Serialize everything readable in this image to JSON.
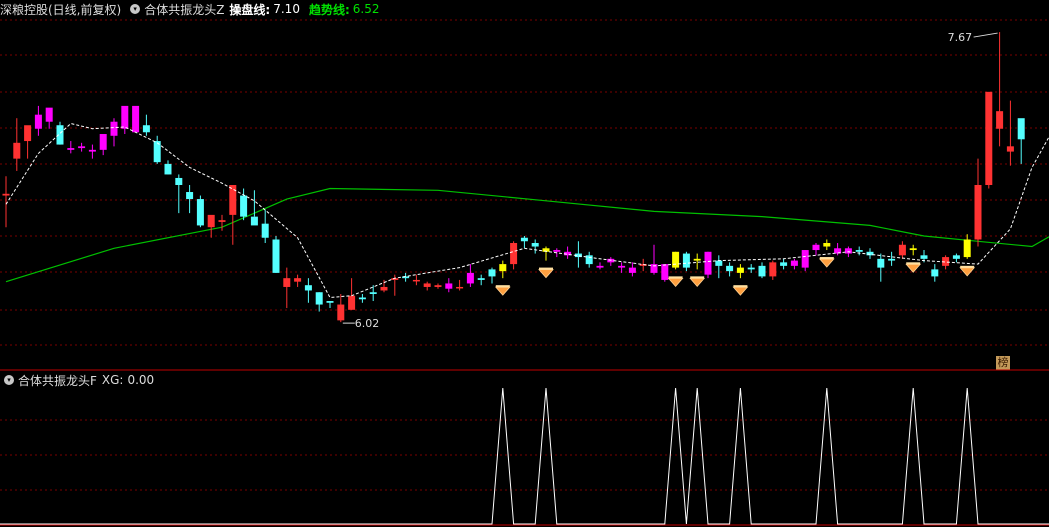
{
  "header": {
    "stock_title": "深粮控股(日线,前复权)",
    "indicator_name": "合体共振龙头Z",
    "cao_label": "操盘线:",
    "cao_value": "7.10",
    "trend_label": "趋势线:",
    "trend_value": "6.52"
  },
  "sub_header": {
    "indicator_name": "合体共振龙头F",
    "xg_label": "XG:",
    "xg_value": "0.00"
  },
  "badge_text": "榜",
  "colors": {
    "up": "#ff3232",
    "down": "#54ffff",
    "signal_up": "#ff00ff",
    "signal_candle": "#ffff00",
    "trend_line": "#00c000",
    "cao_line": "#ffffff",
    "separator": "#c00000",
    "grid": "#7a0000",
    "xg_line": "#ffffff",
    "diamond": "#ffa040"
  },
  "chart_data": {
    "type": "candlestick",
    "price_range": [
      5.85,
      7.75
    ],
    "max_label": "7.67",
    "min_label": "6.02",
    "candles": [
      {
        "o": 6.74,
        "h": 6.85,
        "l": 6.56,
        "c": 6.75,
        "t": "up"
      },
      {
        "o": 6.95,
        "h": 7.18,
        "l": 6.88,
        "c": 7.04,
        "t": "up"
      },
      {
        "o": 7.05,
        "h": 7.13,
        "l": 6.95,
        "c": 7.14,
        "t": "up"
      },
      {
        "o": 7.12,
        "h": 7.25,
        "l": 7.08,
        "c": 7.2,
        "t": "sig"
      },
      {
        "o": 7.16,
        "h": 7.23,
        "l": 7.12,
        "c": 7.24,
        "t": "sig"
      },
      {
        "o": 7.14,
        "h": 7.16,
        "l": 7.03,
        "c": 7.03,
        "t": "down"
      },
      {
        "o": 7.01,
        "h": 7.05,
        "l": 6.98,
        "c": 7.0,
        "t": "sig"
      },
      {
        "o": 7.01,
        "h": 7.04,
        "l": 6.99,
        "c": 7.02,
        "t": "sig"
      },
      {
        "o": 7.0,
        "h": 7.03,
        "l": 6.95,
        "c": 6.99,
        "t": "sig"
      },
      {
        "o": 7.0,
        "h": 7.08,
        "l": 6.97,
        "c": 7.09,
        "t": "sig"
      },
      {
        "o": 7.08,
        "h": 7.18,
        "l": 7.02,
        "c": 7.16,
        "t": "sig"
      },
      {
        "o": 7.12,
        "h": 7.23,
        "l": 7.09,
        "c": 7.25,
        "t": "sig"
      },
      {
        "o": 7.25,
        "h": 7.2,
        "l": 7.13,
        "c": 7.1,
        "t": "sig"
      },
      {
        "o": 7.14,
        "h": 7.2,
        "l": 7.08,
        "c": 7.1,
        "t": "down"
      },
      {
        "o": 7.05,
        "h": 7.08,
        "l": 6.92,
        "c": 6.93,
        "t": "down"
      },
      {
        "o": 6.92,
        "h": 6.94,
        "l": 6.86,
        "c": 6.86,
        "t": "down"
      },
      {
        "o": 6.84,
        "h": 6.86,
        "l": 6.64,
        "c": 6.8,
        "t": "down"
      },
      {
        "o": 6.76,
        "h": 6.8,
        "l": 6.64,
        "c": 6.72,
        "t": "down"
      },
      {
        "o": 6.72,
        "h": 6.74,
        "l": 6.56,
        "c": 6.57,
        "t": "down"
      },
      {
        "o": 6.56,
        "h": 6.62,
        "l": 6.5,
        "c": 6.63,
        "t": "up"
      },
      {
        "o": 6.59,
        "h": 6.63,
        "l": 6.54,
        "c": 6.6,
        "t": "up"
      },
      {
        "o": 6.63,
        "h": 6.79,
        "l": 6.46,
        "c": 6.8,
        "t": "up"
      },
      {
        "o": 6.74,
        "h": 6.78,
        "l": 6.6,
        "c": 6.62,
        "t": "down"
      },
      {
        "o": 6.62,
        "h": 6.77,
        "l": 6.62,
        "c": 6.57,
        "t": "down"
      },
      {
        "o": 6.58,
        "h": 6.66,
        "l": 6.47,
        "c": 6.5,
        "t": "down"
      },
      {
        "o": 6.49,
        "h": 6.51,
        "l": 6.3,
        "c": 6.3,
        "t": "down"
      },
      {
        "o": 6.22,
        "h": 6.33,
        "l": 6.1,
        "c": 6.27,
        "t": "up"
      },
      {
        "o": 6.25,
        "h": 6.29,
        "l": 6.22,
        "c": 6.27,
        "t": "up"
      },
      {
        "o": 6.23,
        "h": 6.27,
        "l": 6.13,
        "c": 6.2,
        "t": "down"
      },
      {
        "o": 6.12,
        "h": 6.19,
        "l": 6.08,
        "c": 6.19,
        "t": "down"
      },
      {
        "o": 6.14,
        "h": 6.14,
        "l": 6.1,
        "c": 6.13,
        "t": "down"
      },
      {
        "o": 6.03,
        "h": 6.18,
        "l": 6.02,
        "c": 6.12,
        "t": "up"
      },
      {
        "o": 6.09,
        "h": 6.27,
        "l": 6.09,
        "c": 6.17,
        "t": "up"
      },
      {
        "o": 6.16,
        "h": 6.18,
        "l": 6.13,
        "c": 6.15,
        "t": "down"
      },
      {
        "o": 6.19,
        "h": 6.23,
        "l": 6.14,
        "c": 6.18,
        "t": "down"
      },
      {
        "o": 6.2,
        "h": 6.26,
        "l": 6.19,
        "c": 6.22,
        "t": "up"
      },
      {
        "o": 6.26,
        "h": 6.29,
        "l": 6.17,
        "c": 6.27,
        "t": "up"
      },
      {
        "o": 6.28,
        "h": 6.3,
        "l": 6.25,
        "c": 6.27,
        "t": "down"
      },
      {
        "o": 6.26,
        "h": 6.29,
        "l": 6.23,
        "c": 6.26,
        "t": "up"
      },
      {
        "o": 6.24,
        "h": 6.25,
        "l": 6.2,
        "c": 6.22,
        "t": "up"
      },
      {
        "o": 6.22,
        "h": 6.24,
        "l": 6.21,
        "c": 6.23,
        "t": "up"
      },
      {
        "o": 6.24,
        "h": 6.27,
        "l": 6.19,
        "c": 6.21,
        "t": "sig"
      },
      {
        "o": 6.22,
        "h": 6.26,
        "l": 6.2,
        "c": 6.22,
        "t": "up"
      },
      {
        "o": 6.24,
        "h": 6.35,
        "l": 6.22,
        "c": 6.3,
        "t": "sig"
      },
      {
        "o": 6.27,
        "h": 6.29,
        "l": 6.23,
        "c": 6.26,
        "t": "down"
      },
      {
        "o": 6.28,
        "h": 6.33,
        "l": 6.24,
        "c": 6.32,
        "t": "down"
      },
      {
        "o": 6.31,
        "h": 6.37,
        "l": 6.27,
        "c": 6.35,
        "t": "sig"
      },
      {
        "o": 6.35,
        "h": 6.48,
        "l": 6.32,
        "c": 6.47,
        "t": "up"
      },
      {
        "o": 6.48,
        "h": 6.51,
        "l": 6.44,
        "c": 6.5,
        "t": "down"
      },
      {
        "o": 6.47,
        "h": 6.49,
        "l": 6.41,
        "c": 6.45,
        "t": "down"
      },
      {
        "o": 6.42,
        "h": 6.45,
        "l": 6.37,
        "c": 6.44,
        "t": "down"
      },
      {
        "o": 6.43,
        "h": 6.44,
        "l": 6.39,
        "c": 6.42,
        "t": "sig"
      },
      {
        "o": 6.4,
        "h": 6.45,
        "l": 6.38,
        "c": 6.42,
        "t": "sig"
      },
      {
        "o": 6.39,
        "h": 6.48,
        "l": 6.33,
        "c": 6.41,
        "t": "down"
      },
      {
        "o": 6.4,
        "h": 6.42,
        "l": 6.33,
        "c": 6.35,
        "t": "down"
      },
      {
        "o": 6.34,
        "h": 6.36,
        "l": 6.32,
        "c": 6.33,
        "t": "sig"
      },
      {
        "o": 6.36,
        "h": 6.39,
        "l": 6.34,
        "c": 6.38,
        "t": "sig"
      },
      {
        "o": 6.34,
        "h": 6.36,
        "l": 6.3,
        "c": 6.33,
        "t": "sig"
      },
      {
        "o": 6.3,
        "h": 6.36,
        "l": 6.28,
        "c": 6.33,
        "t": "sig"
      },
      {
        "o": 6.34,
        "h": 6.38,
        "l": 6.31,
        "c": 6.35,
        "t": "up"
      },
      {
        "o": 6.35,
        "h": 6.46,
        "l": 6.29,
        "c": 6.3,
        "t": "sig"
      },
      {
        "o": 6.26,
        "h": 6.35,
        "l": 6.25,
        "c": 6.35,
        "t": "sig"
      },
      {
        "o": 6.33,
        "h": 6.42,
        "l": 6.32,
        "c": 6.42,
        "t": "up"
      },
      {
        "o": 6.41,
        "h": 6.42,
        "l": 6.31,
        "c": 6.33,
        "t": "down"
      },
      {
        "o": 6.37,
        "h": 6.41,
        "l": 6.32,
        "c": 6.38,
        "t": "down"
      },
      {
        "o": 6.29,
        "h": 6.42,
        "l": 6.27,
        "c": 6.42,
        "t": "sig"
      },
      {
        "o": 6.37,
        "h": 6.4,
        "l": 6.27,
        "c": 6.34,
        "t": "down"
      },
      {
        "o": 6.34,
        "h": 6.36,
        "l": 6.28,
        "c": 6.31,
        "t": "down"
      },
      {
        "o": 6.33,
        "h": 6.35,
        "l": 6.27,
        "c": 6.3,
        "t": "down"
      },
      {
        "o": 6.32,
        "h": 6.35,
        "l": 6.3,
        "c": 6.33,
        "t": "down"
      },
      {
        "o": 6.34,
        "h": 6.36,
        "l": 6.27,
        "c": 6.28,
        "t": "down"
      },
      {
        "o": 6.28,
        "h": 6.37,
        "l": 6.26,
        "c": 6.36,
        "t": "up"
      },
      {
        "o": 6.34,
        "h": 6.38,
        "l": 6.32,
        "c": 6.36,
        "t": "down"
      },
      {
        "o": 6.37,
        "h": 6.38,
        "l": 6.32,
        "c": 6.34,
        "t": "sig"
      },
      {
        "o": 6.33,
        "h": 6.43,
        "l": 6.31,
        "c": 6.43,
        "t": "sig"
      },
      {
        "o": 6.43,
        "h": 6.47,
        "l": 6.4,
        "c": 6.46,
        "t": "sig"
      },
      {
        "o": 6.47,
        "h": 6.49,
        "l": 6.43,
        "c": 6.45,
        "t": "sig"
      },
      {
        "o": 6.44,
        "h": 6.47,
        "l": 6.4,
        "c": 6.41,
        "t": "sig"
      },
      {
        "o": 6.41,
        "h": 6.45,
        "l": 6.39,
        "c": 6.44,
        "t": "sig"
      },
      {
        "o": 6.43,
        "h": 6.45,
        "l": 6.4,
        "c": 6.42,
        "t": "down"
      },
      {
        "o": 6.42,
        "h": 6.44,
        "l": 6.38,
        "c": 6.4,
        "t": "down"
      },
      {
        "o": 6.38,
        "h": 6.41,
        "l": 6.25,
        "c": 6.33,
        "t": "down"
      },
      {
        "o": 6.38,
        "h": 6.42,
        "l": 6.34,
        "c": 6.37,
        "t": "down"
      },
      {
        "o": 6.4,
        "h": 6.48,
        "l": 6.38,
        "c": 6.46,
        "t": "up"
      },
      {
        "o": 6.44,
        "h": 6.46,
        "l": 6.4,
        "c": 6.43,
        "t": "down"
      },
      {
        "o": 6.4,
        "h": 6.43,
        "l": 6.36,
        "c": 6.38,
        "t": "down"
      },
      {
        "o": 6.32,
        "h": 6.35,
        "l": 6.25,
        "c": 6.28,
        "t": "down"
      },
      {
        "o": 6.34,
        "h": 6.4,
        "l": 6.32,
        "c": 6.39,
        "t": "up"
      },
      {
        "o": 6.38,
        "h": 6.41,
        "l": 6.36,
        "c": 6.4,
        "t": "down"
      },
      {
        "o": 6.39,
        "h": 6.52,
        "l": 6.38,
        "c": 6.49,
        "t": "up"
      },
      {
        "o": 6.49,
        "h": 6.95,
        "l": 6.45,
        "c": 6.8,
        "t": "up"
      },
      {
        "o": 6.8,
        "h": 7.3,
        "l": 6.78,
        "c": 7.33,
        "t": "up"
      },
      {
        "o": 7.12,
        "h": 7.67,
        "l": 7.02,
        "c": 7.22,
        "t": "up"
      },
      {
        "o": 6.99,
        "h": 7.28,
        "l": 6.91,
        "c": 7.02,
        "t": "up"
      },
      {
        "o": 7.06,
        "h": 7.12,
        "l": 6.92,
        "c": 7.18,
        "t": "down"
      }
    ],
    "trend_line": [
      [
        0,
        6.25
      ],
      [
        10,
        6.44
      ],
      [
        20,
        6.56
      ],
      [
        26,
        6.72
      ],
      [
        30,
        6.78
      ],
      [
        40,
        6.77
      ],
      [
        50,
        6.71
      ],
      [
        60,
        6.65
      ],
      [
        70,
        6.62
      ],
      [
        80,
        6.57
      ],
      [
        85,
        6.51
      ],
      [
        90,
        6.48
      ],
      [
        95,
        6.45
      ],
      [
        97,
        6.52
      ]
    ],
    "cao_line": [
      [
        0,
        6.69
      ],
      [
        3,
        6.98
      ],
      [
        6,
        7.15
      ],
      [
        8,
        7.12
      ],
      [
        11,
        7.13
      ],
      [
        14,
        7.04
      ],
      [
        17,
        6.9
      ],
      [
        20,
        6.81
      ],
      [
        23,
        6.71
      ],
      [
        27,
        6.5
      ],
      [
        30,
        6.16
      ],
      [
        32,
        6.17
      ],
      [
        36,
        6.27
      ],
      [
        42,
        6.33
      ],
      [
        48,
        6.44
      ],
      [
        55,
        6.38
      ],
      [
        60,
        6.34
      ],
      [
        66,
        6.37
      ],
      [
        72,
        6.38
      ],
      [
        78,
        6.42
      ],
      [
        85,
        6.37
      ],
      [
        90,
        6.35
      ],
      [
        93,
        6.55
      ],
      [
        95,
        6.9
      ],
      [
        97,
        7.12
      ]
    ],
    "signal_bars": [
      46,
      50,
      62,
      64,
      68,
      76,
      84,
      89
    ],
    "xg_pulses": [
      46,
      50,
      62,
      64,
      68,
      76,
      84,
      89
    ],
    "xg_range": [
      0,
      1
    ]
  }
}
